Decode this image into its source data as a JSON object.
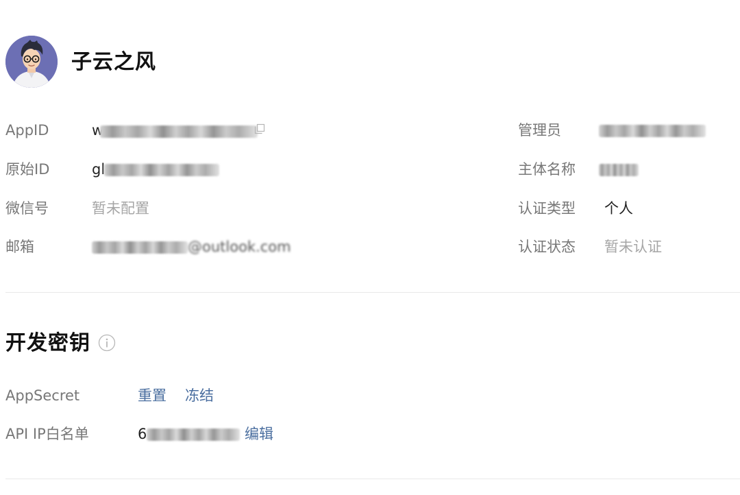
{
  "account": {
    "name": "子云之风"
  },
  "basic_info": {
    "appid_label": "AppID",
    "appid_prefix": "w",
    "original_id_label": "原始ID",
    "original_id_prefix": "gl",
    "wechat_id_label": "微信号",
    "wechat_id_value": "暂未配置",
    "email_label": "邮箱",
    "email_suffix": "@outlook.com",
    "admin_label": "管理员",
    "entity_name_label": "主体名称",
    "cert_type_label": "认证类型",
    "cert_type_value": "个人",
    "cert_status_label": "认证状态",
    "cert_status_value": "暂未认证"
  },
  "dev_keys": {
    "title": "开发密钥",
    "appsecret_label": "AppSecret",
    "reset_label": "重置",
    "freeze_label": "冻结",
    "ip_whitelist_label": "API IP白名单",
    "ip_prefix": "6",
    "edit_label": "编辑"
  },
  "colors": {
    "link": "#4a6e9f",
    "muted": "#a6a6a6",
    "label": "#777777",
    "avatar_bg": "#6c6fb4"
  },
  "icons": {
    "copy": "copy-icon",
    "info": "info-circle-icon",
    "avatar": "avatar-image"
  }
}
